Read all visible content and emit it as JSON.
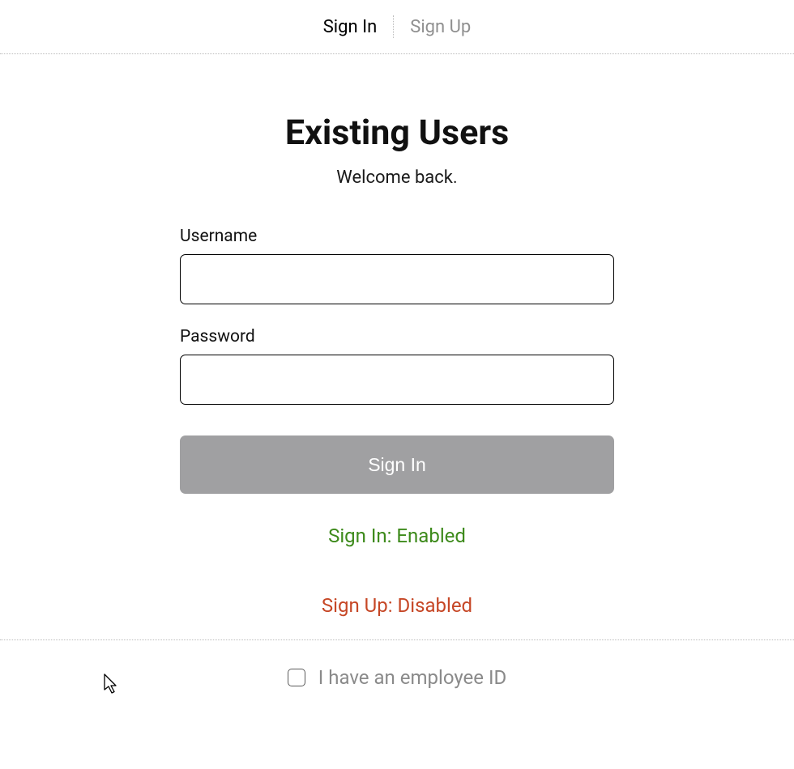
{
  "tabs": {
    "signin": "Sign In",
    "signup": "Sign Up"
  },
  "header": {
    "title": "Existing Users",
    "subtitle": "Welcome back."
  },
  "form": {
    "username_label": "Username",
    "username_value": "",
    "password_label": "Password",
    "password_value": "",
    "submit_label": "Sign In"
  },
  "status": {
    "signin": "Sign In: Enabled",
    "signup": "Sign Up: Disabled"
  },
  "footer": {
    "employee_label": "I have an employee ID",
    "employee_checked": false
  }
}
